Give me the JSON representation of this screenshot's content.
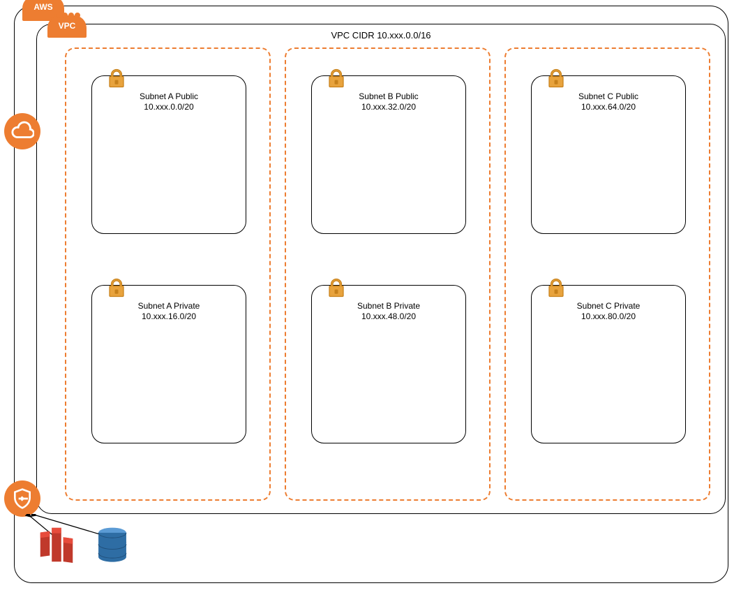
{
  "badges": {
    "aws": "AWS",
    "vpc": "VPC"
  },
  "vpc": {
    "title": "VPC CIDR 10.xxx.0.0/16"
  },
  "azs": {
    "a": {
      "public": {
        "name": "Subnet A Public",
        "cidr": "10.xxx.0.0/20"
      },
      "private": {
        "name": "Subnet A Private",
        "cidr": "10.xxx.16.0/20"
      }
    },
    "b": {
      "public": {
        "name": "Subnet B Public",
        "cidr": "10.xxx.32.0/20"
      },
      "private": {
        "name": "Subnet B Private",
        "cidr": "10.xxx.48.0/20"
      }
    },
    "c": {
      "public": {
        "name": "Subnet C Public",
        "cidr": "10.xxx.64.0/20"
      },
      "private": {
        "name": "Subnet C Private",
        "cidr": "10.xxx.80.0/20"
      }
    }
  },
  "icons": {
    "cloud": "cloud-icon",
    "shield": "shield-icon",
    "lock": "lock-icon",
    "service_red": "redshift-icon",
    "service_blue": "dynamodb-icon"
  },
  "colors": {
    "accent": "#ED7D31",
    "lock_fill": "#E8A33D",
    "lock_stroke": "#C7811B",
    "service_red": "#C0392B",
    "service_blue": "#2E6DA4"
  }
}
